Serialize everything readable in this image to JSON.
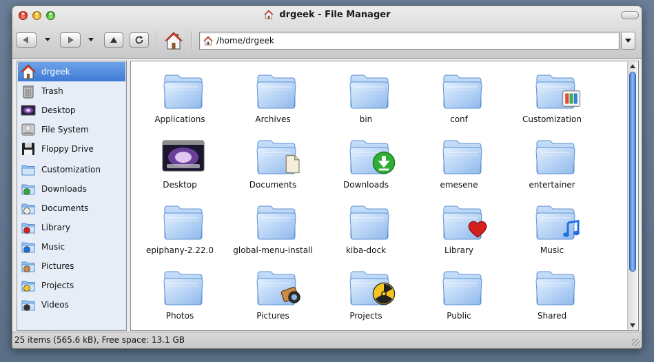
{
  "window": {
    "title": "drgeek - File Manager"
  },
  "toolbar": {
    "back_icon": "arrow-left-icon",
    "forward_icon": "arrow-right-icon",
    "up_icon": "triangle-up-icon",
    "reload_icon": "reload-icon",
    "home_icon": "home-icon"
  },
  "location": {
    "path": "/home/drgeek"
  },
  "sidebar": {
    "items": [
      {
        "label": "drgeek",
        "icon": "home-icon",
        "selected": true
      },
      {
        "label": "Trash",
        "icon": "trash-icon"
      },
      {
        "label": "Desktop",
        "icon": "desktop-icon"
      },
      {
        "label": "File System",
        "icon": "harddisk-icon"
      },
      {
        "label": "Floppy Drive",
        "icon": "floppy-icon"
      },
      {
        "label": "Customization",
        "icon": "folder-icon"
      },
      {
        "label": "Downloads",
        "icon": "folder-downloads-icon"
      },
      {
        "label": "Documents",
        "icon": "folder-documents-icon"
      },
      {
        "label": "Library",
        "icon": "folder-library-icon"
      },
      {
        "label": "Music",
        "icon": "folder-music-icon"
      },
      {
        "label": "Pictures",
        "icon": "folder-pictures-icon"
      },
      {
        "label": "Projects",
        "icon": "folder-projects-icon"
      },
      {
        "label": "Videos",
        "icon": "folder-videos-icon"
      }
    ]
  },
  "files": [
    {
      "name": "Applications",
      "badge": ""
    },
    {
      "name": "Archives",
      "badge": ""
    },
    {
      "name": "bin",
      "badge": ""
    },
    {
      "name": "conf",
      "badge": ""
    },
    {
      "name": "Customization",
      "badge": "palette"
    },
    {
      "name": "Desktop",
      "badge": "desktop"
    },
    {
      "name": "Documents",
      "badge": "document"
    },
    {
      "name": "Downloads",
      "badge": "download"
    },
    {
      "name": "emesene",
      "badge": ""
    },
    {
      "name": "entertainer",
      "badge": ""
    },
    {
      "name": "epiphany-2.22.0",
      "badge": ""
    },
    {
      "name": "global-menu-install",
      "badge": ""
    },
    {
      "name": "kiba-dock",
      "badge": ""
    },
    {
      "name": "Library",
      "badge": "heart"
    },
    {
      "name": "Music",
      "badge": "note"
    },
    {
      "name": "Photos",
      "badge": ""
    },
    {
      "name": "Pictures",
      "badge": "camera"
    },
    {
      "name": "Projects",
      "badge": "radiation"
    },
    {
      "name": "Public",
      "badge": ""
    },
    {
      "name": "Shared",
      "badge": ""
    }
  ],
  "status": {
    "text": "25 items (565.6 kB), Free space: 13.1 GB"
  },
  "colors": {
    "selection": "#3d7ad6",
    "folder": "#9cc3ef",
    "scroll_thumb": "#4c86db"
  }
}
